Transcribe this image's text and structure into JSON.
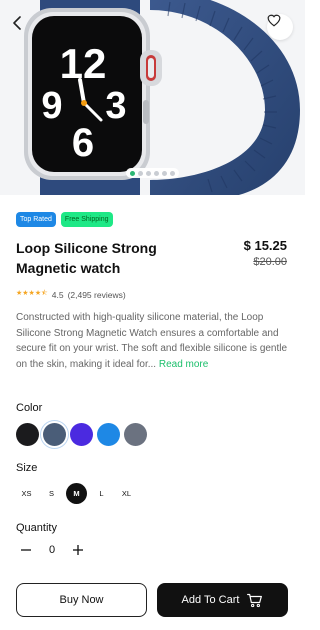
{
  "product": {
    "badges": [
      "Top Rated",
      "Free Shipping"
    ],
    "title": "Loop Silicone Strong Magnetic watch",
    "price": "$ 15.25",
    "old_price": "$20.00",
    "rating_value": "4.5",
    "review_count": "(2,495 reviews)",
    "stars": 4.5,
    "description": "Constructed with high-quality silicone material, the Loop Silicone Strong Magnetic Watch ensures a comfortable and secure fit on your wrist. The soft and flexible silicone is gentle on the skin, making it ideal for...",
    "read_more": "Read more"
  },
  "gallery": {
    "total": 6,
    "active": 0
  },
  "watch_face": {
    "hour_top": "12",
    "hour_left": "9",
    "hour_right": "3",
    "hour_bottom": "6"
  },
  "color_section": {
    "label": "Color",
    "options": [
      "#1b1b1d",
      "#4a5d78",
      "#4b2ae0",
      "#1e88e5",
      "#6b7280"
    ],
    "selected": 1
  },
  "size_section": {
    "label": "Size",
    "options": [
      "XS",
      "S",
      "M",
      "L",
      "XL"
    ],
    "selected": "M"
  },
  "quantity_section": {
    "label": "Quantity",
    "value": "0"
  },
  "actions": {
    "buy_now": "Buy Now",
    "add_to_cart": "Add To Cart"
  },
  "icons": {
    "back": "chevron-left-icon",
    "favorite": "heart-icon",
    "cart": "cart-icon"
  }
}
